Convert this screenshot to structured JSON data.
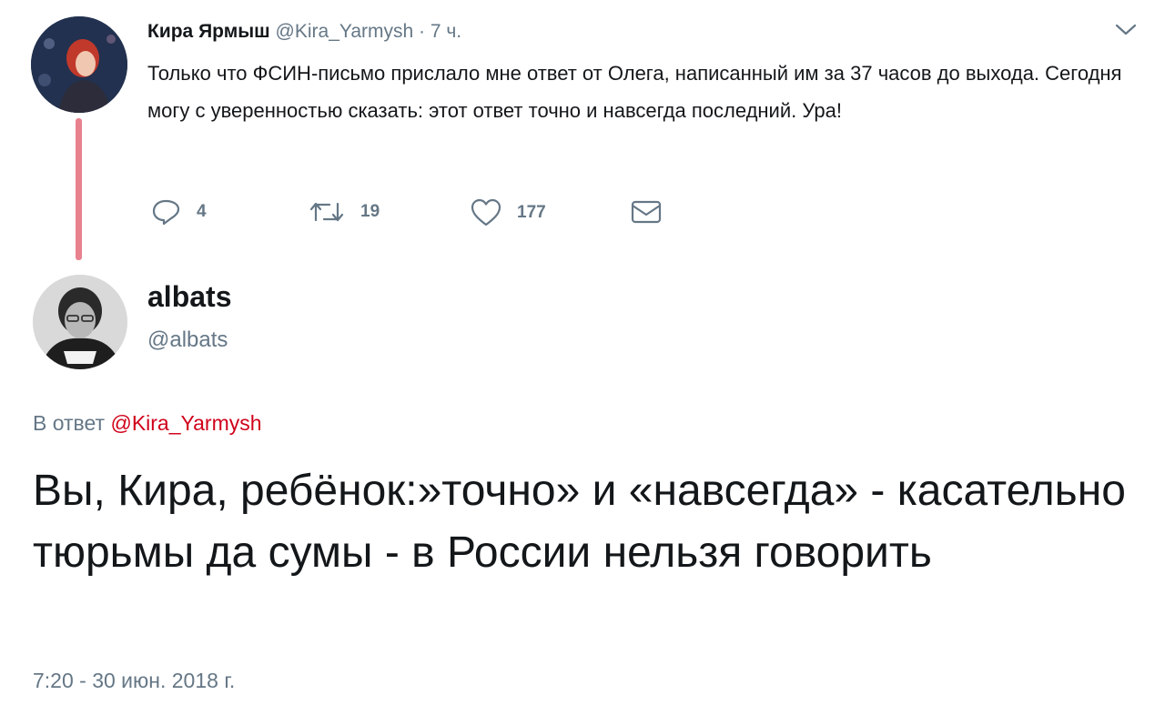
{
  "parent_tweet": {
    "author_name": "Кира Ярмыш",
    "author_handle": "@Kira_Yarmysh",
    "time": "· 7 ч.",
    "text": "Только что ФСИН-письмо прислало мне ответ от Олега, написанный им за 37 часов до выхода. Сегодня могу с уверенностью сказать: этот ответ точно и навсегда последний. Ура!",
    "actions": {
      "replies": "4",
      "retweets": "19",
      "likes": "177"
    }
  },
  "reply_tweet": {
    "author_name": "albats",
    "author_handle": "@albats",
    "reply_prefix": "В ответ",
    "reply_to_handle": "@Kira_Yarmysh",
    "text": "Вы, Кира, ребёнок:»точно» и «навсегда» - касательно тюрьмы да сумы - в России нельзя говорить",
    "timestamp": "7:20 - 30 июн. 2018 г."
  },
  "colors": {
    "thread_line": "#e8818e",
    "muted": "#657786",
    "mention": "#d0021b",
    "text": "#14171a"
  },
  "icons": [
    "reply-icon",
    "retweet-icon",
    "like-icon",
    "direct-message-icon",
    "caret-down-icon"
  ]
}
